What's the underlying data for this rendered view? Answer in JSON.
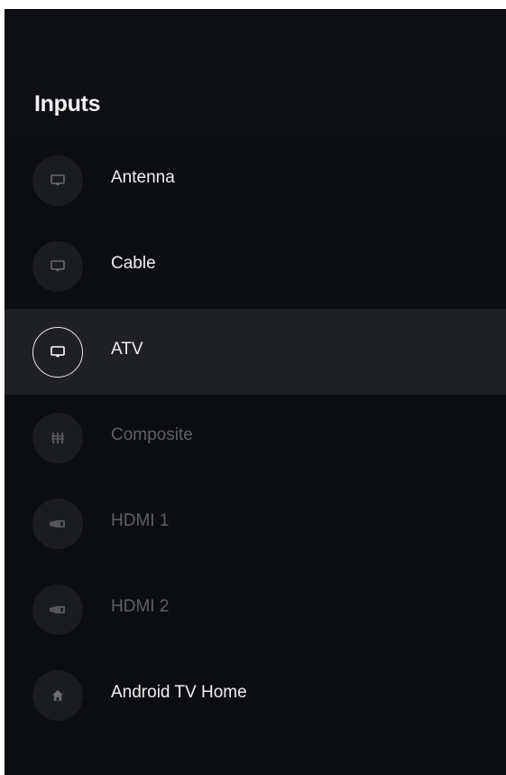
{
  "panel": {
    "title": "Inputs"
  },
  "inputs": [
    {
      "label": "Antenna",
      "icon": "tv-icon",
      "state": "enabled"
    },
    {
      "label": "Cable",
      "icon": "tv-icon",
      "state": "enabled"
    },
    {
      "label": "ATV",
      "icon": "tv-icon",
      "state": "selected"
    },
    {
      "label": "Composite",
      "icon": "composite-icon",
      "state": "disabled"
    },
    {
      "label": "HDMI 1",
      "icon": "hdmi-icon",
      "state": "disabled"
    },
    {
      "label": "HDMI 2",
      "icon": "hdmi-icon",
      "state": "disabled"
    },
    {
      "label": "Android TV Home",
      "icon": "home-icon",
      "state": "enabled"
    }
  ],
  "colors": {
    "background": "#0b0d11",
    "selected_row": "#1f2024",
    "icon_circle": "#1b1c20",
    "text": "#f0f0f0",
    "text_disabled": "#5f6064"
  }
}
